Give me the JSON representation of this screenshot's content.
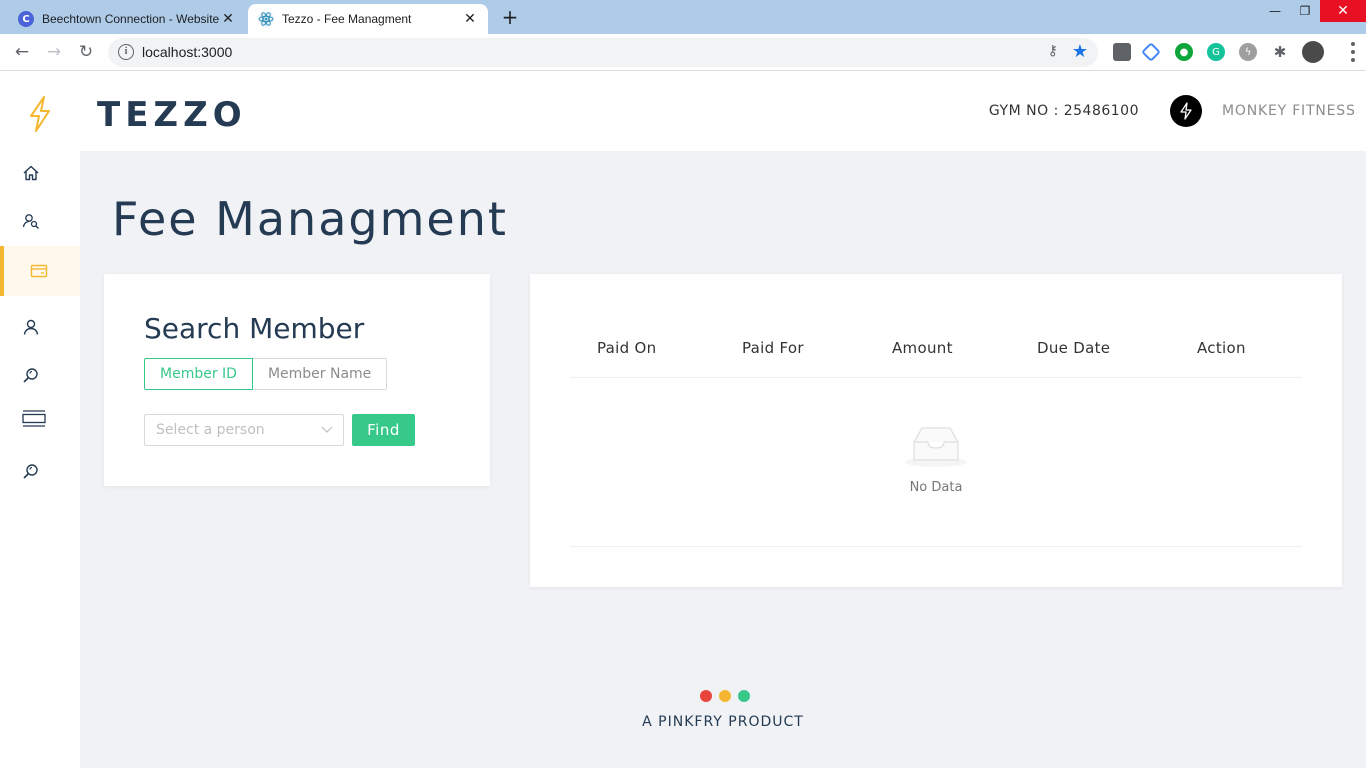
{
  "browser": {
    "tabs": [
      {
        "label": "Beechtown Connection - Website",
        "favicon": "C",
        "favicon_color": "#4a63d8",
        "active": false
      },
      {
        "label": "Tezzo - Fee Managment",
        "favicon": "react-icon",
        "favicon_color": "#2f8fb8",
        "active": true
      }
    ],
    "url": "localhost:3000",
    "accent": "#1a73e8"
  },
  "header": {
    "logo": "TEZZO",
    "gym_no": "GYM NO : 25486100",
    "gym_name": "MONKEY FITNESS"
  },
  "sidebar": {
    "items": [
      {
        "icon": "home-icon",
        "active": false
      },
      {
        "icon": "user-search-icon",
        "active": false
      },
      {
        "icon": "card-icon",
        "active": true
      },
      {
        "icon": "user-icon",
        "active": false
      },
      {
        "icon": "search-icon",
        "active": false
      },
      {
        "icon": "list-icon",
        "active": false
      },
      {
        "icon": "search-icon",
        "active": false
      }
    ]
  },
  "main": {
    "title": "Fee Managment",
    "search": {
      "title": "Search Member",
      "options": [
        "Member ID",
        "Member Name"
      ],
      "selected": "Member ID",
      "select_placeholder": "Select a person",
      "find_label": "Find"
    },
    "table": {
      "columns": [
        "Paid On",
        "Paid For",
        "Amount",
        "Due Date",
        "Action"
      ],
      "rows": [],
      "empty_text": "No Data"
    }
  },
  "footer": {
    "text": "A PINKFRY PRODUCT",
    "dot_colors": [
      "#e8463c",
      "#f5b731",
      "#37c98a"
    ]
  },
  "colors": {
    "primary": "#37c98a",
    "brand_dark": "#243b53",
    "accent_yellow": "#f5b731"
  }
}
